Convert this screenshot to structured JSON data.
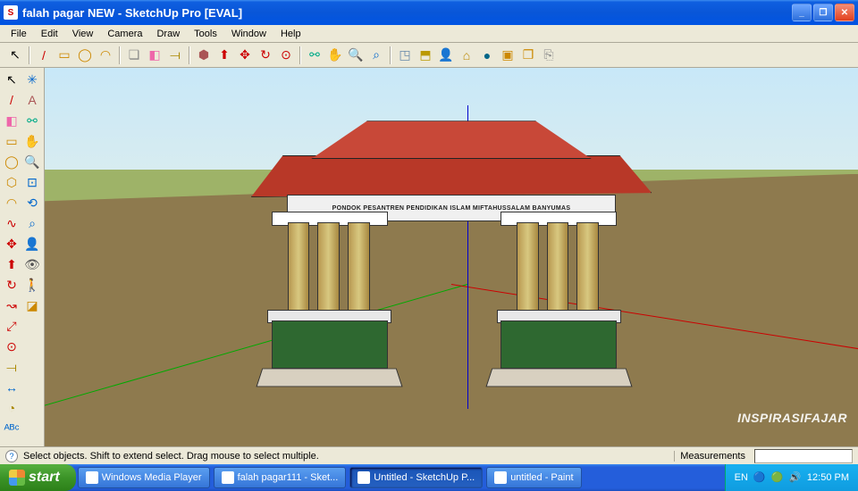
{
  "titlebar": {
    "text": "falah pagar NEW - SketchUp Pro [EVAL]"
  },
  "menu": {
    "items": [
      "File",
      "Edit",
      "View",
      "Camera",
      "Draw",
      "Tools",
      "Window",
      "Help"
    ]
  },
  "toolbar_top": [
    {
      "name": "select-arrow-icon",
      "glyph": "↖",
      "color": "#000"
    },
    {
      "name": "sep"
    },
    {
      "name": "line-icon",
      "glyph": "/",
      "color": "#c00"
    },
    {
      "name": "rectangle-icon",
      "glyph": "▭",
      "color": "#c80"
    },
    {
      "name": "circle-icon",
      "glyph": "◯",
      "color": "#c80"
    },
    {
      "name": "arc-icon",
      "glyph": "◠",
      "color": "#c80"
    },
    {
      "name": "sep"
    },
    {
      "name": "make-component-icon",
      "glyph": "❏",
      "color": "#888"
    },
    {
      "name": "eraser-icon",
      "glyph": "◧",
      "color": "#e6a"
    },
    {
      "name": "tape-icon",
      "glyph": "⟞",
      "color": "#a80"
    },
    {
      "name": "sep"
    },
    {
      "name": "paint-icon",
      "glyph": "⬢",
      "color": "#a55"
    },
    {
      "name": "pushpull-icon",
      "glyph": "⬆",
      "color": "#c00"
    },
    {
      "name": "move-icon",
      "glyph": "✥",
      "color": "#c00"
    },
    {
      "name": "rotate-icon",
      "glyph": "↻",
      "color": "#c00"
    },
    {
      "name": "offset-icon",
      "glyph": "⊙",
      "color": "#c00"
    },
    {
      "name": "sep"
    },
    {
      "name": "orbit-icon",
      "glyph": "⚯",
      "color": "#0a8"
    },
    {
      "name": "pan-icon",
      "glyph": "✋",
      "color": "#ea5"
    },
    {
      "name": "zoom-icon",
      "glyph": "🔍",
      "color": "#06c"
    },
    {
      "name": "zoom-extents-icon",
      "glyph": "⌕",
      "color": "#06c"
    },
    {
      "name": "sep"
    },
    {
      "name": "add-location-icon",
      "glyph": "◳",
      "color": "#68a"
    },
    {
      "name": "get-models-icon",
      "glyph": "⬒",
      "color": "#b90"
    },
    {
      "name": "person-icon",
      "glyph": "👤",
      "color": "#268"
    },
    {
      "name": "building-icon",
      "glyph": "⌂",
      "color": "#b80"
    },
    {
      "name": "earth-icon",
      "glyph": "●",
      "color": "#068"
    },
    {
      "name": "photo-icon",
      "glyph": "▣",
      "color": "#c80"
    },
    {
      "name": "layers-icon",
      "glyph": "❐",
      "color": "#c80"
    },
    {
      "name": "export-icon",
      "glyph": "⎘",
      "color": "#888"
    }
  ],
  "toolbar_side": [
    {
      "name": "select-icon",
      "glyph": "↖",
      "color": "#000"
    },
    {
      "name": "line-icon",
      "glyph": "/",
      "color": "#c00"
    },
    {
      "name": "eraser-icon",
      "glyph": "◧",
      "color": "#e6a"
    },
    {
      "name": "rectangle-icon",
      "glyph": "▭",
      "color": "#c80"
    },
    {
      "name": "circle-icon",
      "glyph": "◯",
      "color": "#c80"
    },
    {
      "name": "polygon-icon",
      "glyph": "⬡",
      "color": "#c80"
    },
    {
      "name": "arc-icon",
      "glyph": "◠",
      "color": "#c80"
    },
    {
      "name": "freehand-icon",
      "glyph": "∿",
      "color": "#c00"
    },
    {
      "name": "move-icon",
      "glyph": "✥",
      "color": "#c00"
    },
    {
      "name": "pushpull-icon",
      "glyph": "⬆",
      "color": "#c00"
    },
    {
      "name": "rotate-icon",
      "glyph": "↻",
      "color": "#c00"
    },
    {
      "name": "followme-icon",
      "glyph": "↝",
      "color": "#c00"
    },
    {
      "name": "scale-icon",
      "glyph": "⤢",
      "color": "#c00"
    },
    {
      "name": "offset-icon",
      "glyph": "⊙",
      "color": "#c00"
    },
    {
      "name": "tape-icon",
      "glyph": "⟞",
      "color": "#a80"
    },
    {
      "name": "dimension-icon",
      "glyph": "↔",
      "color": "#06c"
    },
    {
      "name": "protractor-icon",
      "glyph": "◔",
      "color": "#a80"
    },
    {
      "name": "text-icon",
      "glyph": "ᴬᴮᶜ",
      "color": "#06c"
    },
    {
      "name": "axes-icon",
      "glyph": "✳",
      "color": "#06c"
    },
    {
      "name": "3dtext-icon",
      "glyph": "A",
      "color": "#a55"
    },
    {
      "name": "orbit-icon",
      "glyph": "⚯",
      "color": "#0a8"
    },
    {
      "name": "pan-icon",
      "glyph": "✋",
      "color": "#ea5"
    },
    {
      "name": "zoom-icon",
      "glyph": "🔍",
      "color": "#06c"
    },
    {
      "name": "zoom-window-icon",
      "glyph": "⊡",
      "color": "#06c"
    },
    {
      "name": "previous-icon",
      "glyph": "⟲",
      "color": "#06c"
    },
    {
      "name": "zoom-extents-icon",
      "glyph": "⌕",
      "color": "#06c"
    },
    {
      "name": "position-camera-icon",
      "glyph": "👤",
      "color": "#555"
    },
    {
      "name": "look-around-icon",
      "glyph": "👁",
      "color": "#555"
    },
    {
      "name": "walk-icon",
      "glyph": "🚶",
      "color": "#555"
    },
    {
      "name": "section-icon",
      "glyph": "◪",
      "color": "#c80"
    }
  ],
  "model": {
    "sign_text": "PONDOK PESANTREN PENDIDIKAN ISLAM MIFTAHUSSALAM BANYUMAS",
    "watermark": "INSPIRASIFAJAR"
  },
  "statusbar": {
    "hint": "Select objects. Shift to extend select. Drag mouse to select multiple.",
    "measurements_label": "Measurements",
    "measurements_value": ""
  },
  "taskbar": {
    "start": "start",
    "items": [
      {
        "label": "Windows Media Player",
        "active": false
      },
      {
        "label": "falah pagar111 - Sket...",
        "active": false
      },
      {
        "label": "Untitled - SketchUp P...",
        "active": true
      },
      {
        "label": "untitled - Paint",
        "active": false
      }
    ],
    "lang": "EN",
    "time": "12:50 PM"
  }
}
